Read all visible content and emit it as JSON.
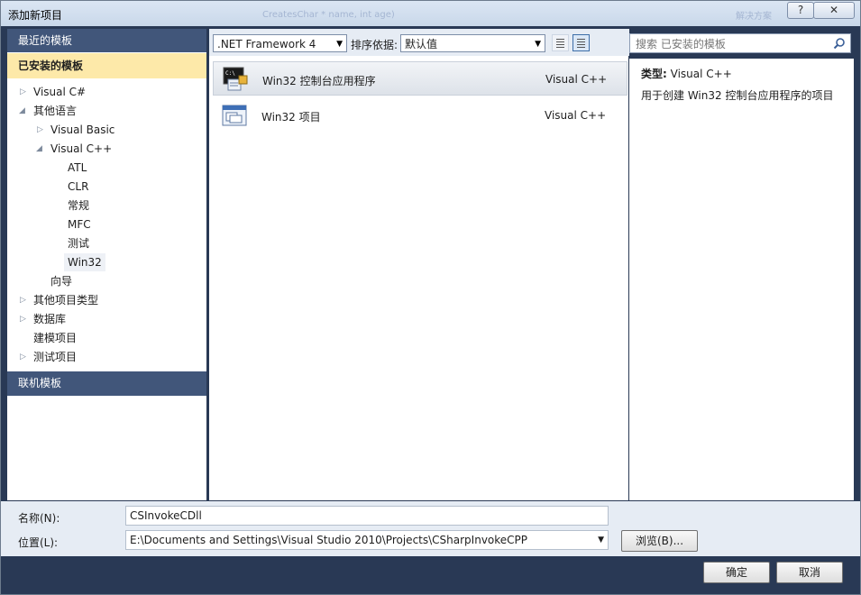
{
  "window": {
    "title": "添加新项目",
    "ghost_title_1": "CreatesChar * name, int age)",
    "ghost_title_2": "解决方案",
    "help_glyph": "?",
    "close_glyph": "✕"
  },
  "left": {
    "recent": "最近的模板",
    "installed": "已安装的模板",
    "online": "联机模板",
    "tree": [
      {
        "label": "Visual C#",
        "arrow": "▷"
      },
      {
        "label": "其他语言",
        "arrow": "◢"
      },
      {
        "label": "Visual Basic",
        "arrow": "▷"
      },
      {
        "label": "Visual C++",
        "arrow": "◢"
      },
      {
        "label": "ATL"
      },
      {
        "label": "CLR"
      },
      {
        "label": "常规"
      },
      {
        "label": "MFC"
      },
      {
        "label": "测试"
      },
      {
        "label": "Win32"
      },
      {
        "label": "向导"
      },
      {
        "label": "其他项目类型",
        "arrow": "▷"
      },
      {
        "label": "数据库",
        "arrow": "▷"
      },
      {
        "label": "建模项目"
      },
      {
        "label": "测试项目",
        "arrow": "▷"
      }
    ]
  },
  "toolbar": {
    "framework": ".NET Framework 4",
    "sort_label": "排序依据:",
    "sort_value": "默认值",
    "dropdown_glyph": "▼"
  },
  "templates": [
    {
      "name": "Win32 控制台应用程序",
      "lang": "Visual C++",
      "icon_text": "C:\\"
    },
    {
      "name": "Win32 项目",
      "lang": "Visual C++"
    }
  ],
  "search": {
    "placeholder": "搜索 已安装的模板"
  },
  "info": {
    "type_label": "类型:",
    "type_value": "Visual C++",
    "description": "用于创建 Win32 控制台应用程序的项目"
  },
  "form": {
    "name_label": "名称(N):",
    "name_value": "CSInvokeCDll",
    "location_label": "位置(L):",
    "location_value": "E:\\Documents and Settings\\Visual Studio 2010\\Projects\\CSharpInvokeCPP",
    "browse": "浏览(B)..."
  },
  "buttons": {
    "ok": "确定",
    "cancel": "取消"
  }
}
